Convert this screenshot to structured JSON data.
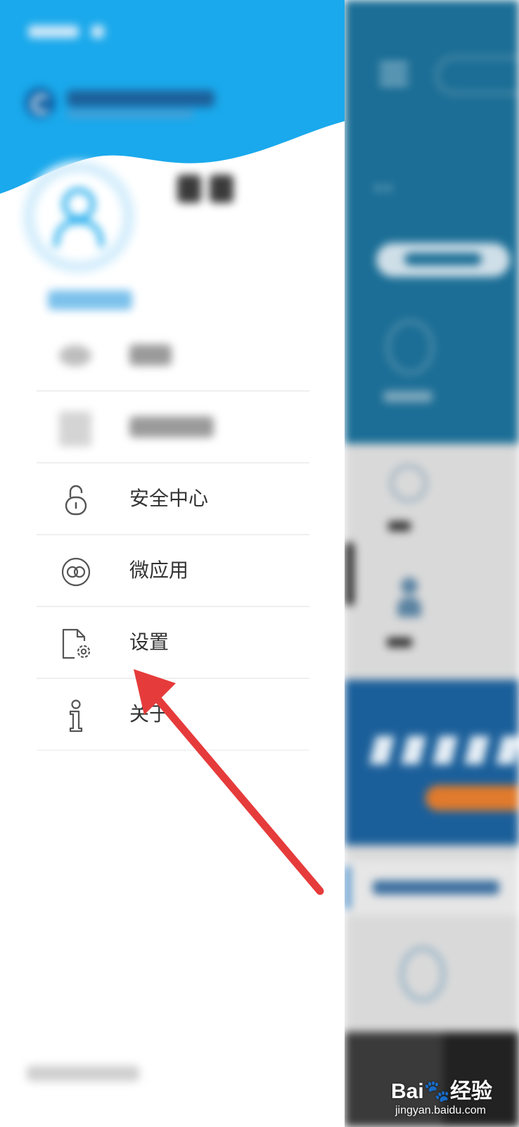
{
  "drawer": {
    "menu": [
      {
        "label": "安全中心",
        "icon": "lock-icon"
      },
      {
        "label": "微应用",
        "icon": "link-icon"
      },
      {
        "label": "设置",
        "icon": "settings-icon"
      },
      {
        "label": "关于",
        "icon": "info-icon"
      }
    ]
  },
  "watermark": {
    "brand": "Bai",
    "brand_cn": "经验",
    "url": "jingyan.baidu.com"
  },
  "colors": {
    "header_blue": "#1aa9ec",
    "arrow_red": "#e63b3b",
    "text": "#333333",
    "divider": "#efefef"
  }
}
